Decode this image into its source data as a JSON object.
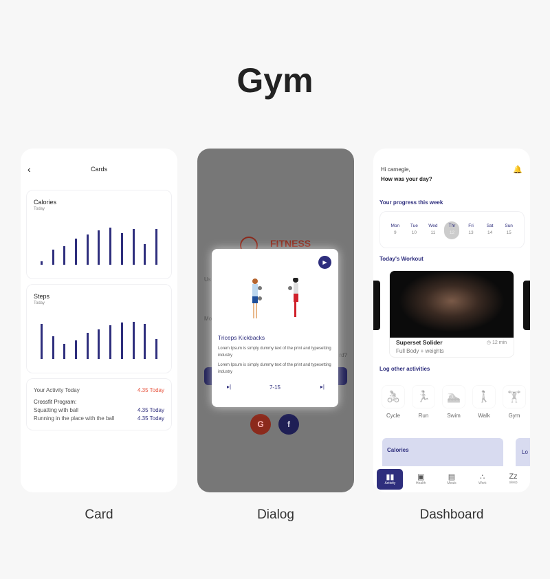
{
  "page_title": "Gym",
  "captions": [
    "Card",
    "Dialog",
    "Dashboard"
  ],
  "card_screen": {
    "header": "Cards",
    "calories": {
      "title": "Calories",
      "subtitle": "Today",
      "values": [
        16,
        67,
        83,
        116,
        133,
        150,
        163,
        140,
        156,
        90,
        156
      ]
    },
    "steps": {
      "title": "Steps",
      "subtitle": "Today",
      "values": [
        156,
        99,
        66,
        83,
        116,
        132,
        149,
        162,
        164,
        156,
        89
      ]
    },
    "activity": {
      "label": "Your Activity Today",
      "value": "4.35 Today",
      "program": "Crossfit Program:",
      "items": [
        {
          "label": "Squatting with ball",
          "value": "4.35 Today"
        },
        {
          "label": "Running in the place with the ball",
          "value": "4.35 Today"
        }
      ]
    },
    "colors": {
      "bar": "#2e2e7d",
      "highlight": "#e8553f"
    }
  },
  "dialog_screen": {
    "bg_logo": "FITNESS",
    "bg_fragments": [
      "Us",
      "Mo",
      "rd?"
    ],
    "title": "Triceps Kickbacks",
    "para1": "Lorem Ipsum is simply dummy text of the print and typesetting industry",
    "para2": "Lorem Ipsum is simply dummy text of the print and typesetting industry",
    "counter": "7-15",
    "social": [
      "G",
      "f"
    ]
  },
  "dashboard": {
    "greeting": "Hi carnegie,",
    "question": "How was your day?",
    "progress_title": "Your progress this week",
    "days": [
      {
        "d": "Mon",
        "n": "9"
      },
      {
        "d": "Tue",
        "n": "10"
      },
      {
        "d": "Wed",
        "n": "11"
      },
      {
        "d": "Thr",
        "n": "12",
        "selected": true
      },
      {
        "d": "Fri",
        "n": "13"
      },
      {
        "d": "Sat",
        "n": "14"
      },
      {
        "d": "Sun",
        "n": "15"
      }
    ],
    "workout_title": "Today's Workout",
    "workout": {
      "name": "Superset Solider",
      "duration": "12 min",
      "type": "Full Body + weights"
    },
    "log_title": "Log other activities",
    "activities": [
      "Cycle",
      "Run",
      "Swim",
      "Walk",
      "Gym"
    ],
    "summary_card": "Calories",
    "summary_card2": "Lo",
    "tabs": [
      "Activity",
      "Health",
      "Meals",
      "Work",
      "sleep"
    ]
  }
}
